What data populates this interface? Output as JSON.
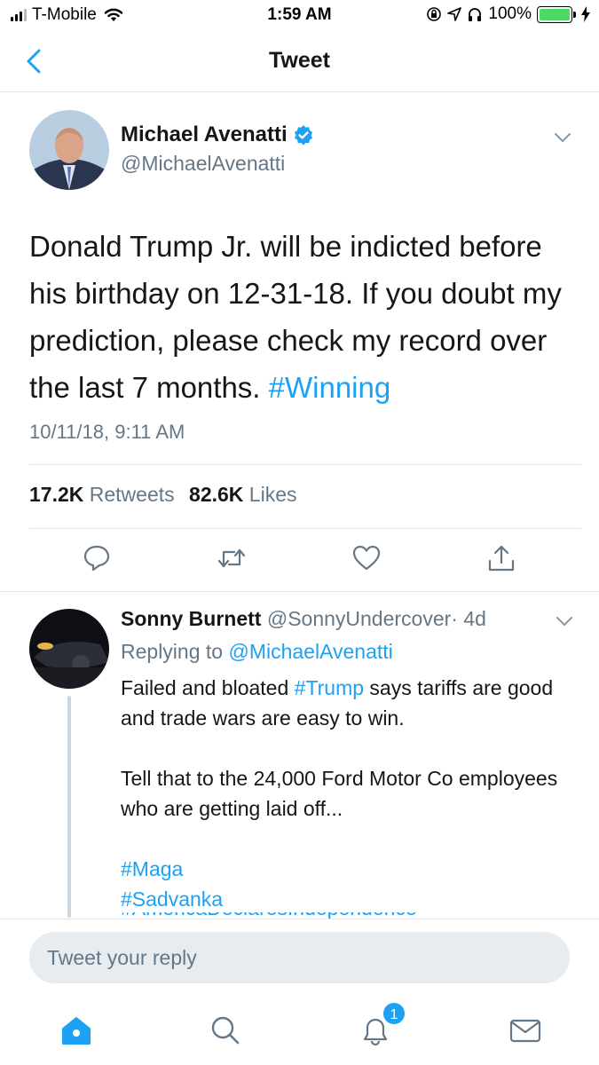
{
  "status_bar": {
    "carrier": "T-Mobile",
    "time": "1:59 AM",
    "battery": "100%",
    "colors": {
      "battery_fill": "#4cd964"
    }
  },
  "nav": {
    "title": "Tweet",
    "back_icon": "chevron-left-icon"
  },
  "tweet": {
    "author_name": "Michael Avenatti",
    "verified": true,
    "handle": "@MichaelAvenatti",
    "text": "Donald Trump Jr. will be indicted before his birthday on 12-31-18. If you doubt my prediction, please check my record over the last 7 months. ",
    "hashtag": "#Winning",
    "timestamp": "10/11/18, 9:11 AM",
    "retweets_count": "17.2K",
    "retweets_label": "Retweets",
    "likes_count": "82.6K",
    "likes_label": "Likes"
  },
  "actions": [
    "reply-icon",
    "retweet-icon",
    "like-icon",
    "share-icon"
  ],
  "reply": {
    "name": "Sonny Burnett",
    "handle": "@SonnyUndercover",
    "separator": "·",
    "age": "4d",
    "replying_prefix": "Replying to ",
    "replying_to": "@MichaelAvenatti",
    "line1_pre": "Failed and bloated ",
    "line1_hashtag": "#Trump",
    "line1_post": " says tariffs are good and trade wars are easy to win.",
    "paragraph2": "Tell that to the 24,000 Ford Motor Co employees who are getting laid off...",
    "hashtag1": "#Maga",
    "hashtag2": "#Sadvanka",
    "hashtag3_cut": "#AmericaDeclaresIndependence"
  },
  "composer": {
    "placeholder": "Tweet your reply"
  },
  "tabbar": {
    "tabs": [
      "home-icon",
      "search-icon",
      "notifications-icon",
      "messages-icon"
    ],
    "notification_badge": "1",
    "colors": {
      "active": "#1da1f2",
      "inactive": "#657786"
    }
  },
  "colors": {
    "link": "#1da1f2",
    "secondary_text": "#657786",
    "primary_text": "#14171a",
    "divider": "#e1e8ed"
  }
}
